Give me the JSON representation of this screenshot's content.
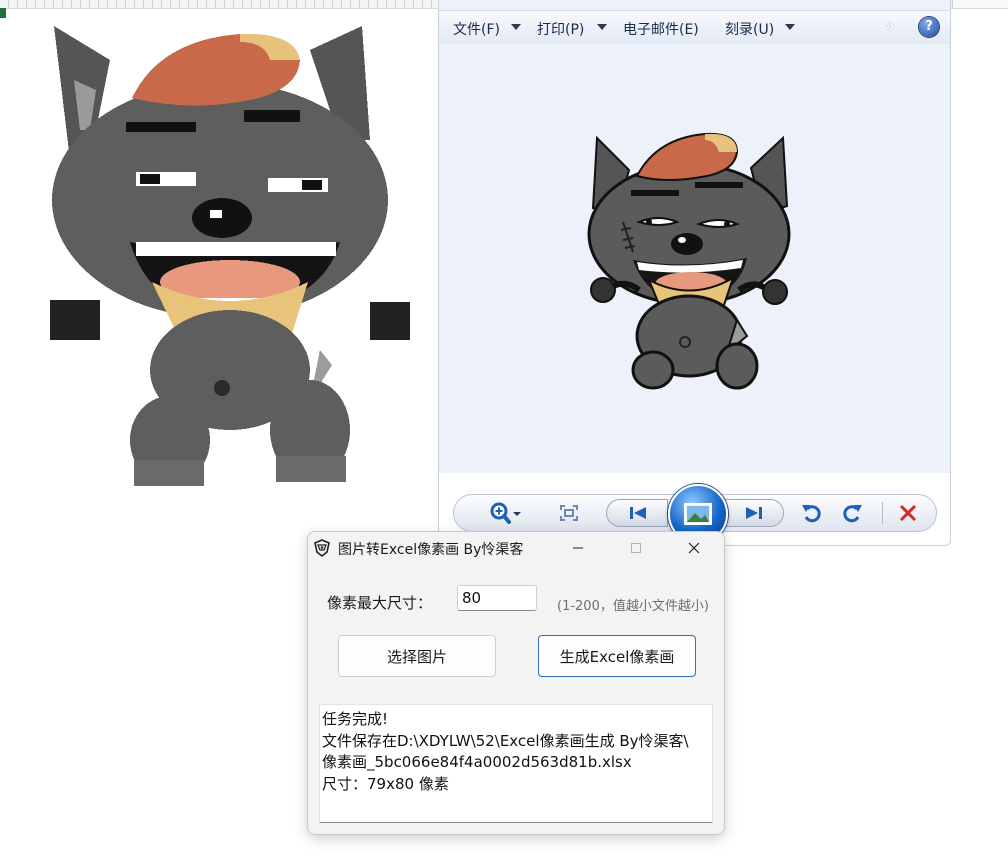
{
  "viewer": {
    "menu": {
      "file": "文件(F)",
      "print": "打印(P)",
      "email": "电子邮件(E)",
      "burn": "刻录(U)"
    },
    "more_icon": "chevrons-right-icon",
    "help_icon": "help-icon",
    "help_glyph": "?",
    "toolbar_icons": [
      "zoom-icon",
      "fit-window-icon",
      "previous-icon",
      "slideshow-icon",
      "next-icon",
      "rotate-left-icon",
      "rotate-right-icon",
      "delete-icon"
    ],
    "accent": "#1f5fb8",
    "delete_color": "#d42a2a"
  },
  "dialog": {
    "title": "图片转Excel像素画 By怜渠客",
    "size_label": "像素最大尺寸：",
    "size_value": "80",
    "size_hint": "(1-200，值越小文件越小)",
    "select_button": "选择图片",
    "generate_button": "生成Excel像素画",
    "log": [
      "任务完成!",
      "文件保存在D:\\XDYLW\\52\\Excel像素画生成 By怜渠客\\",
      "像素画_5bc066e84f4a0002d563d81b.xlsx",
      "尺寸：79x80 像素"
    ]
  },
  "colors": {
    "wolf_body": "#5a5a5a",
    "hat": "#c8694a",
    "scarf": "#e8c37a",
    "excel_green": "#1e7145"
  }
}
